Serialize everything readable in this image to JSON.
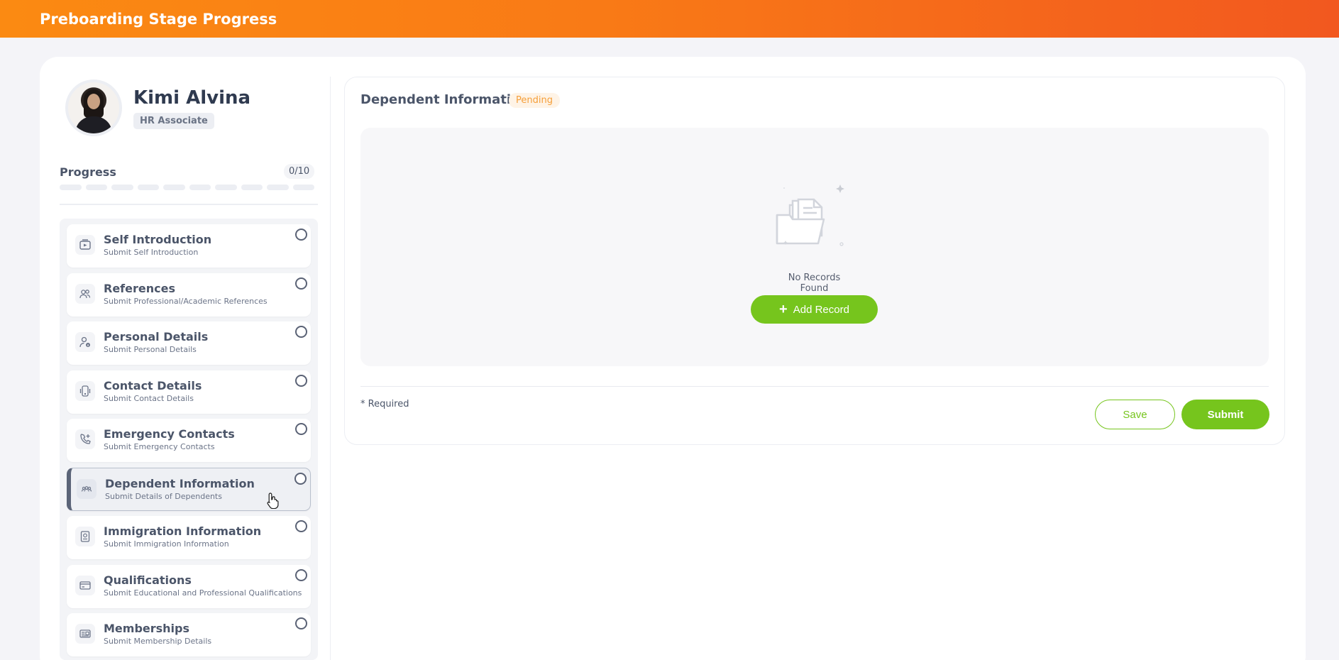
{
  "header": {
    "title": "Preboarding Stage Progress"
  },
  "profile": {
    "name": "Kimi Alvina",
    "role": "HR Associate"
  },
  "progress": {
    "label": "Progress",
    "count": "0/10",
    "completed_fraction": 0
  },
  "steps": [
    {
      "title": "Self Introduction",
      "subtitle": "Submit Self Introduction",
      "icon": "video-icon"
    },
    {
      "title": "References",
      "subtitle": "Submit Professional/Academic References",
      "icon": "people-icon"
    },
    {
      "title": "Personal Details",
      "subtitle": "Submit Personal Details",
      "icon": "user-info-icon"
    },
    {
      "title": "Contact Details",
      "subtitle": "Submit Contact Details",
      "icon": "phone-vibrate-icon"
    },
    {
      "title": "Emergency Contacts",
      "subtitle": "Submit Emergency Contacts",
      "icon": "phone-add-icon"
    },
    {
      "title": "Dependent Information",
      "subtitle": "Submit Details of Dependents",
      "icon": "group-icon",
      "active": true
    },
    {
      "title": "Immigration Information",
      "subtitle": "Submit Immigration Information",
      "icon": "passport-icon"
    },
    {
      "title": "Qualifications",
      "subtitle": "Submit Educational and Professional Qualifications",
      "icon": "card-icon"
    },
    {
      "title": "Memberships",
      "subtitle": "Submit Membership Details",
      "icon": "id-card-icon"
    }
  ],
  "panel": {
    "title": "Dependent Information",
    "status": "Pending",
    "empty_text": "No Records Found",
    "add_label": "Add Record",
    "required_note": "* Required",
    "save_label": "Save",
    "submit_label": "Submit"
  },
  "colors": {
    "accent_orange": "#f97a16",
    "accent_green": "#76c51d",
    "pending": "#f59f3a"
  }
}
